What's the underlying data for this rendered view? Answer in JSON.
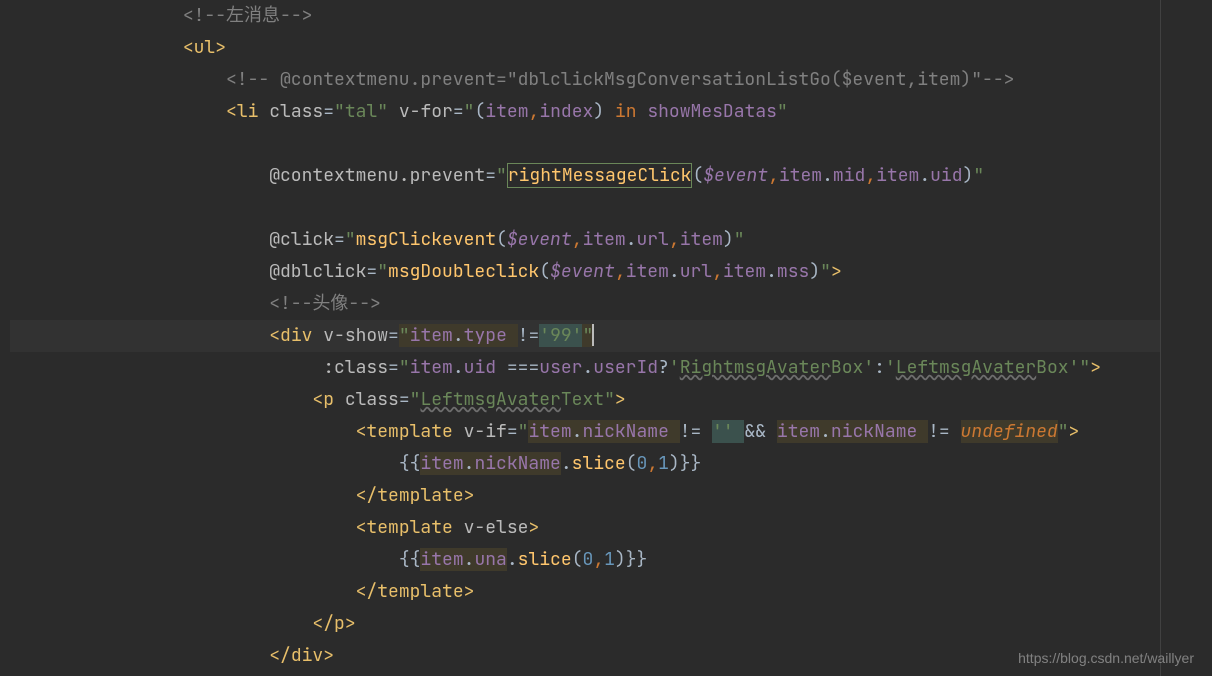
{
  "watermark": "https://blog.csdn.net/waillyer",
  "code": {
    "l1": {
      "indent": "                ",
      "comment_open": "<!--",
      "txt": "左消息",
      "comment_close": "-->"
    },
    "l2": {
      "indent": "                ",
      "open": "<",
      "tag": "ul",
      "close": ">"
    },
    "l3": {
      "indent": "                    ",
      "open": "<!-- ",
      "attr": "@contextmenu.prevent",
      "eq": "=",
      "str": "\"dblclickMsgConversationListGo($event,item)\"",
      "close": "-->"
    },
    "l4": {
      "indent": "                    ",
      "open": "<",
      "tag": "li ",
      "attr1": "class",
      "eq1": "=",
      "q1": "\"",
      "v1": "tal",
      "q1b": "\" ",
      "attr2": "v-for",
      "eq2": "=",
      "q2": "\"",
      "p": "(",
      "id1": "item",
      "comma": ",",
      "id2": "index",
      "pc": ") ",
      "kw": "in ",
      "id3": "showMesDatas",
      "q2b": "\""
    },
    "l5": {
      "indent": ""
    },
    "l6": {
      "indent": "                        ",
      "attr": "@contextmenu.prevent",
      "eq": "=",
      "q": "\"",
      "fn": "rightMessageClick",
      "p": "(",
      "ev": "$event",
      "c1": ",",
      "id1": "item",
      "d1": ".",
      "id2": "mid",
      "c2": ",",
      "id3": "item",
      "d2": ".",
      "id4": "uid",
      "pc": ")",
      "qe": "\""
    },
    "l7": {
      "indent": ""
    },
    "l8": {
      "indent": "                        ",
      "attr": "@click",
      "eq": "=",
      "q": "\"",
      "fn": "msgClickevent",
      "p": "(",
      "ev": "$event",
      "c1": ",",
      "id1": "item",
      "d1": ".",
      "id2": "url",
      "c2": ",",
      "id3": "item",
      "pc": ")",
      "qe": "\""
    },
    "l9": {
      "indent": "                        ",
      "attr": "@dblclick",
      "eq": "=",
      "q": "\"",
      "fn": "msgDoubleclick",
      "p": "(",
      "ev": "$event",
      "c1": ",",
      "id1": "item",
      "d1": ".",
      "id2": "url",
      "c2": ",",
      "id3": "item",
      "d2": ".",
      "id4": "mss",
      "pc": ")",
      "qe": "\"",
      "close": ">"
    },
    "l10": {
      "indent": "                        ",
      "comment_open": "<!--",
      "txt": "头像",
      "comment_close": "-->"
    },
    "l11": {
      "indent": "                        ",
      "open": "<",
      "tag": "div ",
      "attr": "v-show",
      "eq": "=",
      "q": "\"",
      "id1": "item",
      "d": ".",
      "id2": "type ",
      "op": "!=",
      "lit": "'99'",
      "qe": "\""
    },
    "l12": {
      "indent": "                             ",
      "attr": ":class",
      "eq": "=",
      "q": "\"",
      "id1": "item",
      "d": ".",
      "id2": "uid ",
      "op": "===",
      "id3": "user",
      "d2": ".",
      "id4": "userId",
      "qm": "?",
      "sq1": "'",
      "cls1a": "RightmsgAvater",
      "cls1b": "Box",
      "sq1e": "'",
      "colon": ":",
      "sq2": "'",
      "cls2a": "LeftmsgAvater",
      "cls2b": "Box",
      "sq2e": "'",
      "qe": "\"",
      "close": ">"
    },
    "l13": {
      "indent": "                            ",
      "open": "<",
      "tag": "p ",
      "attr": "class",
      "eq": "=",
      "q": "\"",
      "cls1a": "LeftmsgAvater",
      "cls1b": "Text",
      "qe": "\"",
      "close": ">"
    },
    "l14": {
      "indent": "                                ",
      "open": "<",
      "tag": "template ",
      "attr": "v-if",
      "eq": "=",
      "q": "\"",
      "id1": "item",
      "d1": ".",
      "id2": "nickName ",
      "op1": "!= ",
      "lit1": "'' ",
      "amp": "&& ",
      "id3": "item",
      "d2": ".",
      "id4": "nickName ",
      "op2": "!= ",
      "undef": "undefined",
      "qe": "\"",
      "close": ">"
    },
    "l15": {
      "indent": "                                    ",
      "bo": "{{",
      "id1": "item",
      "d1": ".",
      "id2": "nickName",
      "d2": ".",
      "fn": "slice",
      "p": "(",
      "n1": "0",
      "c": ",",
      "n2": "1",
      "pc": ")",
      "bc": "}}"
    },
    "l16": {
      "indent": "                                ",
      "open": "</",
      "tag": "template",
      "close": ">"
    },
    "l17": {
      "indent": "                                ",
      "open": "<",
      "tag": "template ",
      "attr": "v-else",
      "close": ">"
    },
    "l18": {
      "indent": "                                    ",
      "bo": "{{",
      "id1": "item",
      "d1": ".",
      "id2": "una",
      "d2": ".",
      "fn": "slice",
      "p": "(",
      "n1": "0",
      "c": ",",
      "n2": "1",
      "pc": ")",
      "bc": "}}"
    },
    "l19": {
      "indent": "                                ",
      "open": "</",
      "tag": "template",
      "close": ">"
    },
    "l20": {
      "indent": "                            ",
      "open": "</",
      "tag": "p",
      "close": ">"
    },
    "l21": {
      "indent": "                        ",
      "open": "</",
      "tag": "div",
      "close": ">"
    }
  }
}
